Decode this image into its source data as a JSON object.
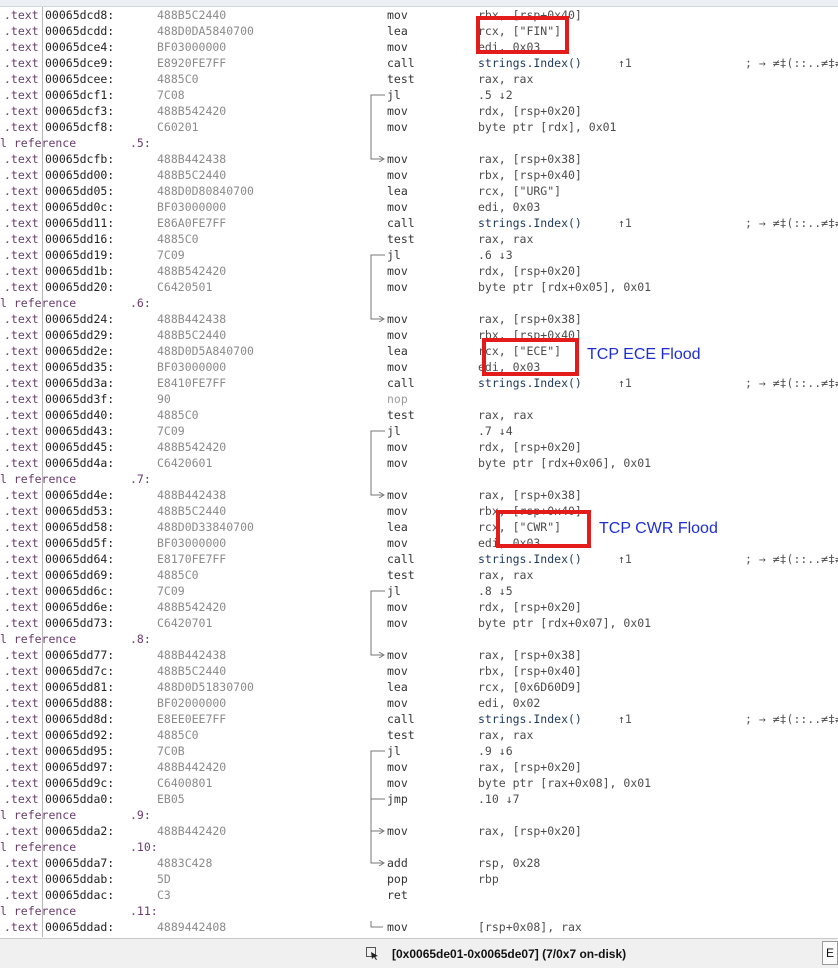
{
  "rows": [
    {
      "kind": "ins",
      "seg": ".text",
      "addr": "00065dcd8:",
      "bytes": "488B5C2440",
      "mn": "mov",
      "ops": "rbx, [rsp+0x40]"
    },
    {
      "kind": "ins",
      "seg": ".text",
      "addr": "00065dcdd:",
      "bytes": "488D0DA5840700",
      "mn": "lea",
      "ops": "rcx, [\"FIN\"]"
    },
    {
      "kind": "ins",
      "seg": ".text",
      "addr": "00065dce4:",
      "bytes": "BF03000000",
      "mn": "mov",
      "ops": "edi, 0x03"
    },
    {
      "kind": "ins",
      "seg": ".text",
      "addr": "00065dce9:",
      "bytes": "E8920FE7FF",
      "mn": "call",
      "ops": "strings.Index()",
      "xref": "↑1",
      "cmt": "; → ≠‡(::..≠‡≠"
    },
    {
      "kind": "ins",
      "seg": ".text",
      "addr": "00065dcee:",
      "bytes": "4885C0",
      "mn": "test",
      "ops": "rax, rax"
    },
    {
      "kind": "ins",
      "seg": ".text",
      "addr": "00065dcf1:",
      "bytes": "7C08",
      "mn": "jl",
      "ops": ".5     ↓2"
    },
    {
      "kind": "ins",
      "seg": ".text",
      "addr": "00065dcf3:",
      "bytes": "488B542420",
      "mn": "mov",
      "ops": "rdx, [rsp+0x20]"
    },
    {
      "kind": "ins",
      "seg": ".text",
      "addr": "00065dcf8:",
      "bytes": "C60201",
      "mn": "mov",
      "ops": "byte ptr [rdx], 0x01"
    },
    {
      "kind": "label",
      "ref": "l reference",
      "label": ".5:"
    },
    {
      "kind": "ins",
      "seg": ".text",
      "addr": "00065dcfb:",
      "bytes": "488B442438",
      "mn": "mov",
      "ops": "rax, [rsp+0x38]"
    },
    {
      "kind": "ins",
      "seg": ".text",
      "addr": "00065dd00:",
      "bytes": "488B5C2440",
      "mn": "mov",
      "ops": "rbx, [rsp+0x40]"
    },
    {
      "kind": "ins",
      "seg": ".text",
      "addr": "00065dd05:",
      "bytes": "488D0D80840700",
      "mn": "lea",
      "ops": "rcx, [\"URG\"]"
    },
    {
      "kind": "ins",
      "seg": ".text",
      "addr": "00065dd0c:",
      "bytes": "BF03000000",
      "mn": "mov",
      "ops": "edi, 0x03"
    },
    {
      "kind": "ins",
      "seg": ".text",
      "addr": "00065dd11:",
      "bytes": "E86A0FE7FF",
      "mn": "call",
      "ops": "strings.Index()",
      "xref": "↑1",
      "cmt": "; → ≠‡(::..≠‡≠"
    },
    {
      "kind": "ins",
      "seg": ".text",
      "addr": "00065dd16:",
      "bytes": "4885C0",
      "mn": "test",
      "ops": "rax, rax"
    },
    {
      "kind": "ins",
      "seg": ".text",
      "addr": "00065dd19:",
      "bytes": "7C09",
      "mn": "jl",
      "ops": ".6     ↓3"
    },
    {
      "kind": "ins",
      "seg": ".text",
      "addr": "00065dd1b:",
      "bytes": "488B542420",
      "mn": "mov",
      "ops": "rdx, [rsp+0x20]"
    },
    {
      "kind": "ins",
      "seg": ".text",
      "addr": "00065dd20:",
      "bytes": "C6420501",
      "mn": "mov",
      "ops": "byte ptr [rdx+0x05], 0x01"
    },
    {
      "kind": "label",
      "ref": "l reference",
      "label": ".6:"
    },
    {
      "kind": "ins",
      "seg": ".text",
      "addr": "00065dd24:",
      "bytes": "488B442438",
      "mn": "mov",
      "ops": "rax, [rsp+0x38]"
    },
    {
      "kind": "ins",
      "seg": ".text",
      "addr": "00065dd29:",
      "bytes": "488B5C2440",
      "mn": "mov",
      "ops": "rbx, [rsp+0x40]"
    },
    {
      "kind": "ins",
      "seg": ".text",
      "addr": "00065dd2e:",
      "bytes": "488D0D5A840700",
      "mn": "lea",
      "ops": "rcx, [\"ECE\"]"
    },
    {
      "kind": "ins",
      "seg": ".text",
      "addr": "00065dd35:",
      "bytes": "BF03000000",
      "mn": "mov",
      "ops": "edi, 0x03"
    },
    {
      "kind": "ins",
      "seg": ".text",
      "addr": "00065dd3a:",
      "bytes": "E8410FE7FF",
      "mn": "call",
      "ops": "strings.Index()",
      "xref": "↑1",
      "cmt": "; → ≠‡(::..≠‡≠"
    },
    {
      "kind": "ins",
      "seg": ".text",
      "addr": "00065dd3f:",
      "bytes": "90",
      "mn": "nop",
      "ops": ""
    },
    {
      "kind": "ins",
      "seg": ".text",
      "addr": "00065dd40:",
      "bytes": "4885C0",
      "mn": "test",
      "ops": "rax, rax"
    },
    {
      "kind": "ins",
      "seg": ".text",
      "addr": "00065dd43:",
      "bytes": "7C09",
      "mn": "jl",
      "ops": ".7     ↓4"
    },
    {
      "kind": "ins",
      "seg": ".text",
      "addr": "00065dd45:",
      "bytes": "488B542420",
      "mn": "mov",
      "ops": "rdx, [rsp+0x20]"
    },
    {
      "kind": "ins",
      "seg": ".text",
      "addr": "00065dd4a:",
      "bytes": "C6420601",
      "mn": "mov",
      "ops": "byte ptr [rdx+0x06], 0x01"
    },
    {
      "kind": "label",
      "ref": "l reference",
      "label": ".7:"
    },
    {
      "kind": "ins",
      "seg": ".text",
      "addr": "00065dd4e:",
      "bytes": "488B442438",
      "mn": "mov",
      "ops": "rax, [rsp+0x38]"
    },
    {
      "kind": "ins",
      "seg": ".text",
      "addr": "00065dd53:",
      "bytes": "488B5C2440",
      "mn": "mov",
      "ops": "rbx, [rsp+0x40]"
    },
    {
      "kind": "ins",
      "seg": ".text",
      "addr": "00065dd58:",
      "bytes": "488D0D33840700",
      "mn": "lea",
      "ops": "rcx, [\"CWR\"]"
    },
    {
      "kind": "ins",
      "seg": ".text",
      "addr": "00065dd5f:",
      "bytes": "BF03000000",
      "mn": "mov",
      "ops": "edi, 0x03"
    },
    {
      "kind": "ins",
      "seg": ".text",
      "addr": "00065dd64:",
      "bytes": "E8170FE7FF",
      "mn": "call",
      "ops": "strings.Index()",
      "xref": "↑1",
      "cmt": "; → ≠‡(::..≠‡≠"
    },
    {
      "kind": "ins",
      "seg": ".text",
      "addr": "00065dd69:",
      "bytes": "4885C0",
      "mn": "test",
      "ops": "rax, rax"
    },
    {
      "kind": "ins",
      "seg": ".text",
      "addr": "00065dd6c:",
      "bytes": "7C09",
      "mn": "jl",
      "ops": ".8     ↓5"
    },
    {
      "kind": "ins",
      "seg": ".text",
      "addr": "00065dd6e:",
      "bytes": "488B542420",
      "mn": "mov",
      "ops": "rdx, [rsp+0x20]"
    },
    {
      "kind": "ins",
      "seg": ".text",
      "addr": "00065dd73:",
      "bytes": "C6420701",
      "mn": "mov",
      "ops": "byte ptr [rdx+0x07], 0x01"
    },
    {
      "kind": "label",
      "ref": "l reference",
      "label": ".8:"
    },
    {
      "kind": "ins",
      "seg": ".text",
      "addr": "00065dd77:",
      "bytes": "488B442438",
      "mn": "mov",
      "ops": "rax, [rsp+0x38]"
    },
    {
      "kind": "ins",
      "seg": ".text",
      "addr": "00065dd7c:",
      "bytes": "488B5C2440",
      "mn": "mov",
      "ops": "rbx, [rsp+0x40]"
    },
    {
      "kind": "ins",
      "seg": ".text",
      "addr": "00065dd81:",
      "bytes": "488D0D51830700",
      "mn": "lea",
      "ops": "rcx, [0x6D60D9]"
    },
    {
      "kind": "ins",
      "seg": ".text",
      "addr": "00065dd88:",
      "bytes": "BF02000000",
      "mn": "mov",
      "ops": "edi, 0x02"
    },
    {
      "kind": "ins",
      "seg": ".text",
      "addr": "00065dd8d:",
      "bytes": "E8EE0EE7FF",
      "mn": "call",
      "ops": "strings.Index()",
      "xref": "↑1",
      "cmt": "; → ≠‡(::..≠‡≠"
    },
    {
      "kind": "ins",
      "seg": ".text",
      "addr": "00065dd92:",
      "bytes": "4885C0",
      "mn": "test",
      "ops": "rax, rax"
    },
    {
      "kind": "ins",
      "seg": ".text",
      "addr": "00065dd95:",
      "bytes": "7C0B",
      "mn": "jl",
      "ops": ".9     ↓6"
    },
    {
      "kind": "ins",
      "seg": ".text",
      "addr": "00065dd97:",
      "bytes": "488B442420",
      "mn": "mov",
      "ops": "rax, [rsp+0x20]"
    },
    {
      "kind": "ins",
      "seg": ".text",
      "addr": "00065dd9c:",
      "bytes": "C6400801",
      "mn": "mov",
      "ops": "byte ptr [rax+0x08], 0x01"
    },
    {
      "kind": "ins",
      "seg": ".text",
      "addr": "00065dda0:",
      "bytes": "EB05",
      "mn": "jmp",
      "ops": ".10     ↓7"
    },
    {
      "kind": "label",
      "ref": "l reference",
      "label": ".9:"
    },
    {
      "kind": "ins",
      "seg": ".text",
      "addr": "00065dda2:",
      "bytes": "488B442420",
      "mn": "mov",
      "ops": "rax, [rsp+0x20]"
    },
    {
      "kind": "label",
      "ref": "l reference",
      "label": ".10:"
    },
    {
      "kind": "ins",
      "seg": ".text",
      "addr": "00065dda7:",
      "bytes": "4883C428",
      "mn": "add",
      "ops": "rsp, 0x28"
    },
    {
      "kind": "ins",
      "seg": ".text",
      "addr": "00065ddab:",
      "bytes": "5D",
      "mn": "pop",
      "ops": "rbp"
    },
    {
      "kind": "ins",
      "seg": ".text",
      "addr": "00065ddac:",
      "bytes": "C3",
      "mn": "ret",
      "ops": ""
    },
    {
      "kind": "label",
      "ref": "l reference",
      "label": ".11:"
    },
    {
      "kind": "ins",
      "seg": ".text",
      "addr": "00065ddad:",
      "bytes": "4889442408",
      "mn": "mov",
      "ops": "[rsp+0x08], rax"
    }
  ],
  "annotations": {
    "ece_note": "TCP ECE Flood",
    "cwr_note": "TCP CWR Flood"
  },
  "statusbar": {
    "range": "[0x0065de01-0x0065de07] (7/0x7 on-disk)",
    "corner": "E"
  },
  "colors": {
    "highlight_box": "#e31b1b",
    "annotation_text": "#1f2ed1",
    "segment_text": "#6a3b6e"
  }
}
